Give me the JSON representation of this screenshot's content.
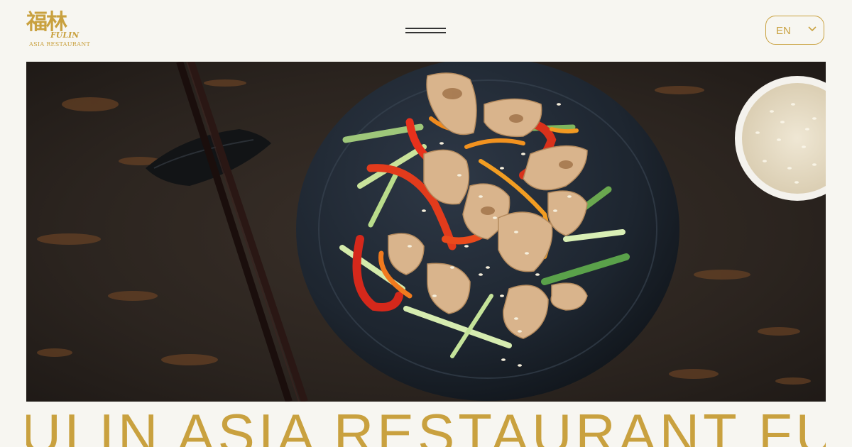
{
  "header": {
    "logo": {
      "cjk": "福林",
      "wordmark": "FULIN",
      "subtitle": "ASIA RESTAURANT"
    },
    "menu": {
      "icon": "hamburger-icon"
    },
    "language": {
      "selected": "EN",
      "icon": "chevron-down-icon"
    }
  },
  "hero": {
    "image": "stir-fried chicken with peppers, cucumber and sesame on a dark plate, chopsticks and a bowl of sesame seeds"
  },
  "marquee": {
    "text": "FULIN ASIA RESTAURANT FULIN ASIA RESTAURANT"
  },
  "colors": {
    "accent": "#c9a13f",
    "background": "#f7f6f1",
    "menu_line": "#333333"
  }
}
